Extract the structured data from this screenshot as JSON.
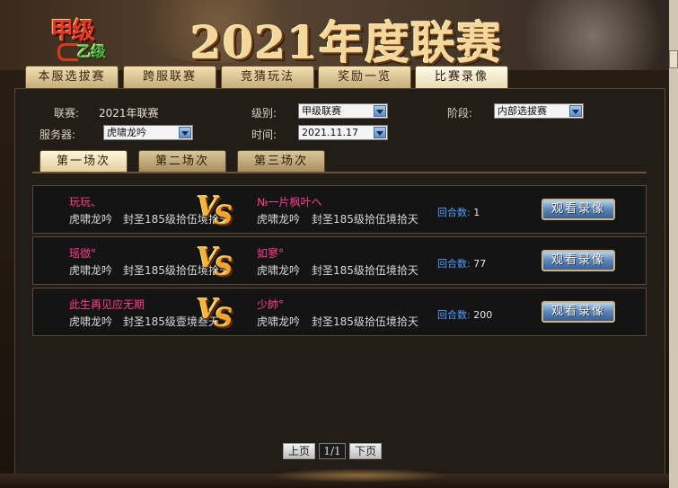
{
  "header": {
    "logo_main": "甲级",
    "logo_sub": "乙级",
    "title": "2021年度联赛"
  },
  "tabs": [
    {
      "label": "本服选拔赛",
      "active": false
    },
    {
      "label": "跨服联赛",
      "active": false
    },
    {
      "label": "竞猜玩法",
      "active": false
    },
    {
      "label": "奖励一览",
      "active": false
    },
    {
      "label": "比赛录像",
      "active": true
    }
  ],
  "filters": {
    "league_label": "联赛:",
    "league_value": "2021年联赛",
    "level_label": "级别:",
    "level_value": "甲级联赛",
    "stage_label": "阶段:",
    "stage_value": "内部选拔赛",
    "server_label": "服务器:",
    "server_value": "虎啸龙吟",
    "time_label": "时间:",
    "time_value": "2021.11.17"
  },
  "sub_tabs": [
    {
      "label": "第一场次",
      "active": true
    },
    {
      "label": "第二场次",
      "active": false
    },
    {
      "label": "第三场次",
      "active": false
    }
  ],
  "matches": [
    {
      "left_name": "玩玩、",
      "left_server": "虎啸龙吟",
      "left_title": "封圣185级拾伍境拾天",
      "right_name": "№一片枫叶ヘ",
      "right_server": "虎啸龙吟",
      "right_title": "封圣185级拾伍境拾天",
      "rounds_label": "回合数:",
      "rounds": "1",
      "watch_label": "观看录像"
    },
    {
      "left_name": "瑶㣲°",
      "left_server": "虎啸龙吟",
      "left_title": "封圣185级拾伍境拾天",
      "right_name": "如寥°",
      "right_server": "虎啸龙吟",
      "right_title": "封圣185级拾伍境拾天",
      "rounds_label": "回合数:",
      "rounds": "77",
      "watch_label": "观看录像"
    },
    {
      "left_name": "此生再见应无期",
      "left_server": "虎啸龙吟",
      "left_title": "封圣185级壹境叁天",
      "right_name": "少帥°",
      "right_server": "虎啸龙吟",
      "right_title": "封圣185级拾伍境拾天",
      "rounds_label": "回合数:",
      "rounds": "200",
      "watch_label": "观看录像"
    }
  ],
  "vs_text": {
    "v": "V",
    "s": "S"
  },
  "pager": {
    "prev": "上页",
    "current": "1/1",
    "next": "下页"
  },
  "colors": {
    "player_name": "#ff3f8e",
    "rounds_label": "#4fa0ff",
    "watch_button": "#5a84b8",
    "title_gold": "#f4d79a"
  }
}
